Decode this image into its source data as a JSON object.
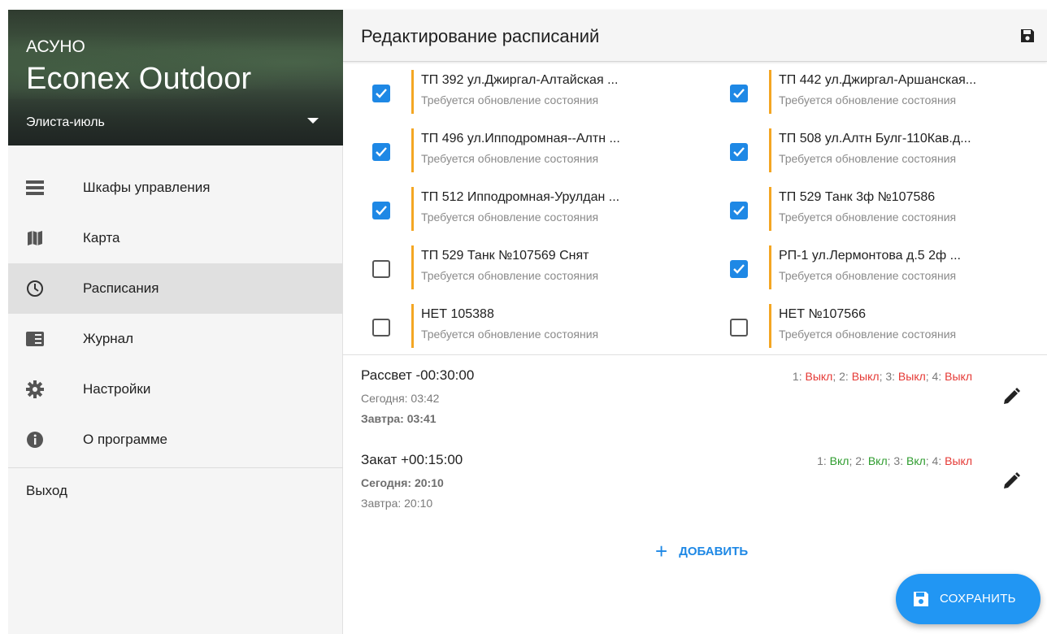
{
  "sidebar": {
    "brand_small": "АСУНО",
    "brand_big": "Econex Outdoor",
    "organization": "Элиста-июль",
    "items": [
      {
        "label": "Шкафы управления",
        "icon": "cabinets-icon"
      },
      {
        "label": "Карта",
        "icon": "map-icon"
      },
      {
        "label": "Расписания",
        "icon": "clock-icon",
        "active": true
      },
      {
        "label": "Журнал",
        "icon": "journal-icon"
      },
      {
        "label": "Настройки",
        "icon": "gear-icon"
      },
      {
        "label": "О программе",
        "icon": "info-icon"
      }
    ],
    "logout": "Выход"
  },
  "header": {
    "title": "Редактирование расписаний",
    "save_icon": "save-icon"
  },
  "cabinets": [
    {
      "name": "ТП 392 ул.Джиргал-Алтайская ...",
      "status": "Требуется обновление состояния",
      "checked": true
    },
    {
      "name": "ТП 442 ул.Джиргал-Аршанская...",
      "status": "Требуется обновление состояния",
      "checked": true
    },
    {
      "name": "ТП 496 ул.Ипподромная--Алтн ...",
      "status": "Требуется обновление состояния",
      "checked": true
    },
    {
      "name": "ТП 508 ул.Алтн Булг-110Кав.д...",
      "status": "Требуется обновление состояния",
      "checked": true
    },
    {
      "name": "ТП 512 Ипподромная-Урулдан ...",
      "status": "Требуется обновление состояния",
      "checked": true
    },
    {
      "name": "ТП 529  Танк  3ф №107586",
      "status": "Требуется обновление состояния",
      "checked": true
    },
    {
      "name": "ТП 529 Танк    №107569 Снят",
      "status": "Требуется обновление состояния",
      "checked": false
    },
    {
      "name": "РП-1 ул.Лермонтова д.5   2ф  ...",
      "status": "Требуется обновление состояния",
      "checked": true
    },
    {
      "name": "НЕТ  105388",
      "status": "Требуется обновление состояния",
      "checked": false
    },
    {
      "name": "НЕТ  №107566",
      "status": "Требуется обновление состояния",
      "checked": false
    }
  ],
  "schedules": [
    {
      "title": "Рассвет -00:30:00",
      "today": "Сегодня: 03:42",
      "tomorrow": "Завтра: 03:41",
      "relays": {
        "r1": "1: ",
        "v1": "Выкл",
        "r2": "; 2: ",
        "v2": "Выкл",
        "r3": "; 3: ",
        "v3": "Выкл",
        "r4": "; 4: ",
        "v4": "Выкл"
      }
    },
    {
      "title": "Закат +00:15:00",
      "today": "Сегодня: 20:10",
      "tomorrow": "Завтра: 20:10",
      "relays": {
        "r1": "1: ",
        "v1": "Вкл",
        "r2": "; 2: ",
        "v2": "Вкл",
        "r3": "; 3: ",
        "v3": "Вкл",
        "r4": "; 4: ",
        "v4": "Выкл"
      }
    }
  ],
  "actions": {
    "add_plus": "+",
    "add_label": "ДОБАВИТЬ",
    "save_label": "СОХРАНИТЬ"
  },
  "colors": {
    "accent": "#2196f3",
    "warning_bar": "#f4a623",
    "off": "#e53935",
    "on": "#2e9c2e"
  }
}
